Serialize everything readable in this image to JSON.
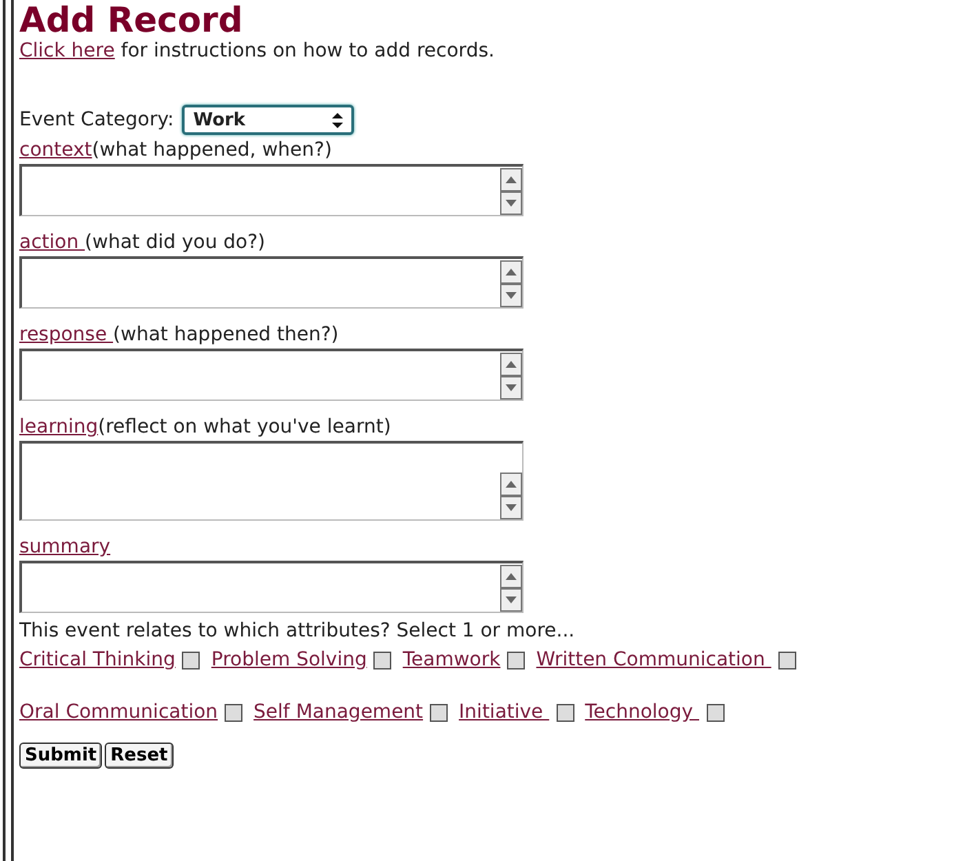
{
  "title": "Add Record",
  "intro": {
    "link": "Click here",
    "text": " for instructions on how to add records."
  },
  "category": {
    "label": "Event Category:",
    "value": "Work"
  },
  "fields": [
    {
      "link": "context",
      "hint": "(what happened, when?)",
      "kind": "textarea"
    },
    {
      "link": "action ",
      "hint": "(what did you do?)",
      "kind": "textarea"
    },
    {
      "link": "response ",
      "hint": "(what happened then?)",
      "kind": "textarea"
    },
    {
      "link": "learning",
      "hint": "(reflect on what you've learnt)",
      "kind": "large_textarea"
    },
    {
      "link": "summary",
      "kind": "textarea"
    }
  ],
  "attributes_prompt": "This event relates to which attributes? Select 1 or more...",
  "attribute_rows": [
    [
      {
        "label": "Critical Thinking",
        "checked": false
      },
      {
        "label": "Problem Solving",
        "checked": false
      },
      {
        "label": "Teamwork",
        "checked": false
      },
      {
        "label": "Written Communication ",
        "checked": false
      }
    ],
    [
      {
        "label": "Oral Communication",
        "checked": false
      },
      {
        "label": "Self Management",
        "checked": false
      },
      {
        "label": "Initiative ",
        "checked": false
      },
      {
        "label": "Technology ",
        "checked": false
      }
    ]
  ],
  "buttons": [
    "Submit",
    "Reset"
  ]
}
